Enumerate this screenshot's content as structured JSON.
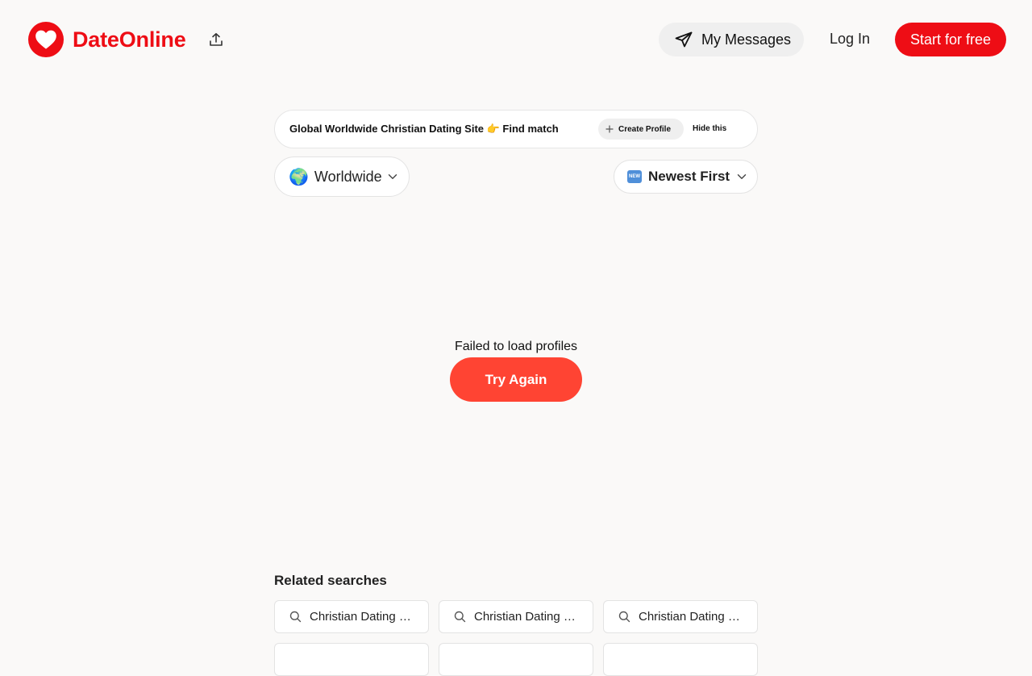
{
  "brand": {
    "name": "DateOnline",
    "color": "#ee0d15",
    "logo_icon": "heart-icon"
  },
  "header": {
    "share_icon": "share-upload-icon",
    "messages_label": "My Messages",
    "messages_icon": "paper-plane-icon",
    "login_label": "Log In",
    "start_label": "Start for free"
  },
  "banner": {
    "text": "Global Worldwide Christian Dating Site 👉 Find match",
    "create_label": "Create Profile",
    "create_icon": "plus-icon",
    "hide_label": "Hide this"
  },
  "filters": {
    "location_emoji": "🌍",
    "location_label": "Worldwide",
    "sort_badge": "NEW",
    "sort_label": "Newest First"
  },
  "status": {
    "error_text": "Failed to load profiles",
    "retry_label": "Try Again",
    "retry_color": "#ff4433"
  },
  "related": {
    "title": "Related searches",
    "items": [
      {
        "label": "Christian Dating …"
      },
      {
        "label": "Christian Dating …"
      },
      {
        "label": "Christian Dating …"
      }
    ]
  }
}
